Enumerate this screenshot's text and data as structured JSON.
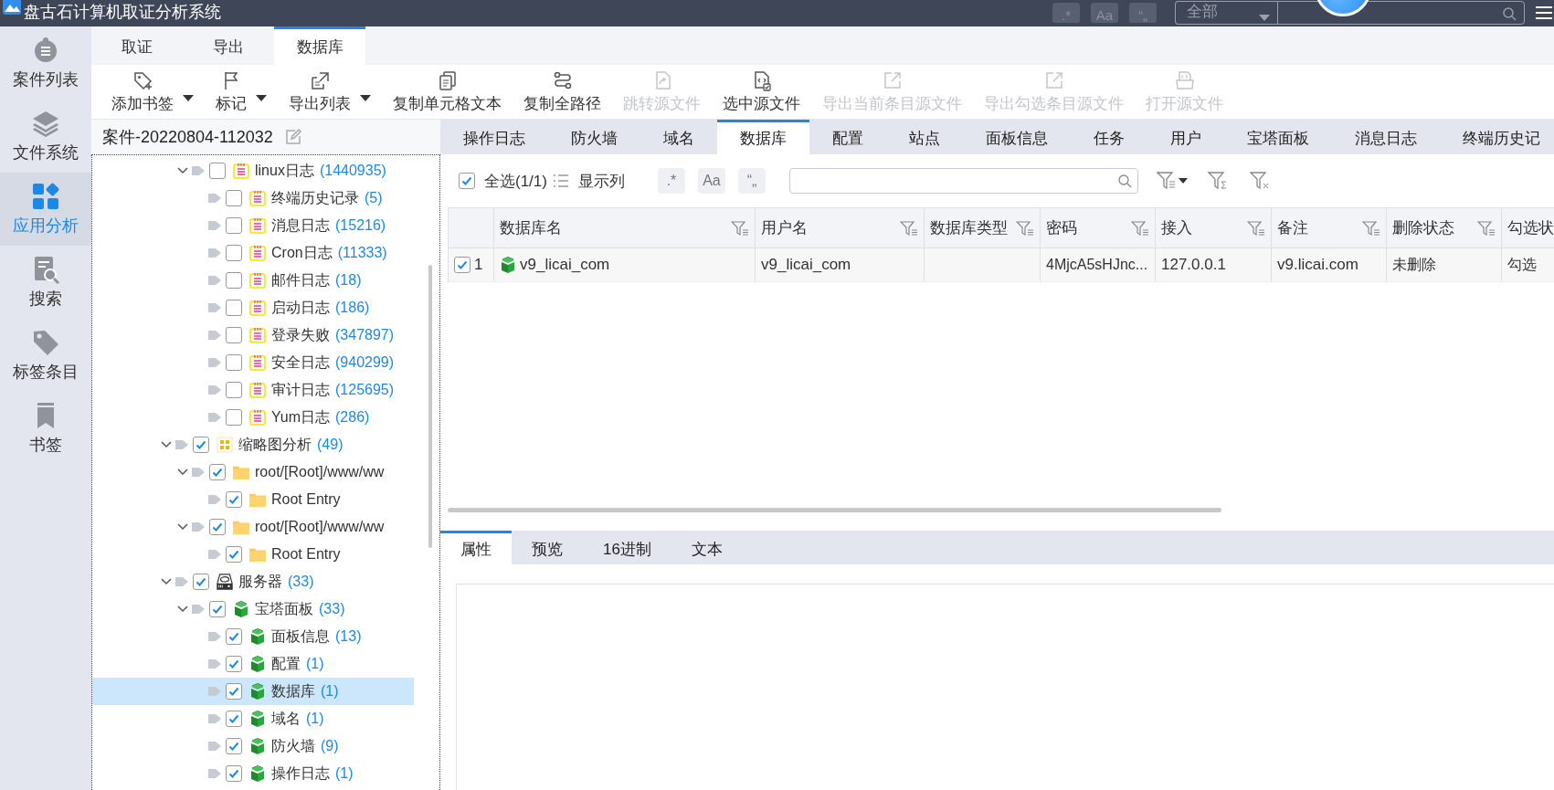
{
  "window": {
    "title": "盘古石计算机取证分析系统"
  },
  "topbar": {
    "toggles": [
      ".*",
      "Aa",
      "“„"
    ],
    "scope": "全部"
  },
  "sidebar": {
    "items": [
      {
        "label": "案件列表",
        "kind": "case",
        "selected": false
      },
      {
        "label": "文件系统",
        "kind": "layers",
        "selected": false
      },
      {
        "label": "应用分析",
        "kind": "apps",
        "selected": true
      },
      {
        "label": "搜索",
        "kind": "search",
        "selected": false
      },
      {
        "label": "标签条目",
        "kind": "tag",
        "selected": false
      },
      {
        "label": "书签",
        "kind": "bookmark",
        "selected": false
      }
    ]
  },
  "menu_tabs": [
    {
      "label": "取证",
      "selected": false
    },
    {
      "label": "导出",
      "selected": false
    },
    {
      "label": "数据库",
      "selected": true
    }
  ],
  "toolbar": [
    {
      "label": "添加书签",
      "kind": "tag",
      "dropdown": true,
      "disabled": false
    },
    {
      "label": "标记",
      "kind": "flag",
      "dropdown": true,
      "disabled": false
    },
    {
      "label": "导出列表",
      "kind": "export",
      "dropdown": true,
      "disabled": false
    },
    {
      "label": "复制单元格文本",
      "kind": "copy",
      "dropdown": false,
      "disabled": false
    },
    {
      "label": "复制全路径",
      "kind": "path",
      "dropdown": false,
      "disabled": false
    },
    {
      "label": "跳转源文件",
      "kind": "jump",
      "dropdown": false,
      "disabled": true
    },
    {
      "label": "选中源文件",
      "kind": "source",
      "dropdown": false,
      "disabled": false
    },
    {
      "label": "导出当前条目源文件",
      "kind": "external",
      "dropdown": false,
      "disabled": true
    },
    {
      "label": "导出勾选条目源文件",
      "kind": "external",
      "dropdown": false,
      "disabled": true
    },
    {
      "label": "打开源文件",
      "kind": "open",
      "dropdown": false,
      "disabled": true
    }
  ],
  "case": {
    "title": "案件-20220804-112032"
  },
  "tree": {
    "partial_branch": [
      {
        "label": "linux日志",
        "count": "(1440935)",
        "kind": "log",
        "checked": false,
        "selected": false,
        "expanded": true,
        "children": [
          {
            "label": "终端历史记录",
            "count": "(5)",
            "kind": "log",
            "checked": false,
            "selected": false
          },
          {
            "label": "消息日志",
            "count": "(15216)",
            "kind": "log",
            "checked": false,
            "selected": false
          },
          {
            "label": "Cron日志",
            "count": "(11333)",
            "kind": "log",
            "checked": false,
            "selected": false
          },
          {
            "label": "邮件日志",
            "count": "(18)",
            "kind": "log",
            "checked": false,
            "selected": false
          },
          {
            "label": "启动日志",
            "count": "(186)",
            "kind": "log",
            "checked": false,
            "selected": false
          },
          {
            "label": "登录失败",
            "count": "(347897)",
            "kind": "log",
            "checked": false,
            "selected": false
          },
          {
            "label": "安全日志",
            "count": "(940299)",
            "kind": "log",
            "checked": false,
            "selected": false
          },
          {
            "label": "审计日志",
            "count": "(125695)",
            "kind": "log",
            "checked": false,
            "selected": false
          },
          {
            "label": "Yum日志",
            "count": "(286)",
            "kind": "log",
            "checked": false,
            "selected": false
          }
        ]
      }
    ],
    "items": [
      {
        "label": "缩略图分析",
        "count": "(49)",
        "kind": "grid",
        "checked": true,
        "selected": false,
        "expanded": true,
        "children": [
          {
            "label": "root/[Root]/www/ww",
            "kind": "folder",
            "checked": true,
            "selected": false,
            "expanded": true,
            "children": [
              {
                "label": "Root Entry",
                "kind": "folder",
                "checked": true,
                "selected": false
              }
            ]
          },
          {
            "label": "root/[Root]/www/ww",
            "kind": "folder",
            "checked": true,
            "selected": false,
            "expanded": true,
            "children": [
              {
                "label": "Root Entry",
                "kind": "folder",
                "checked": true,
                "selected": false
              }
            ]
          }
        ]
      },
      {
        "label": "服务器",
        "count": "(33)",
        "kind": "server",
        "checked": true,
        "selected": false,
        "expanded": true,
        "children": [
          {
            "label": "宝塔面板",
            "count": "(33)",
            "kind": "bt",
            "checked": true,
            "selected": false,
            "expanded": true,
            "children": [
              {
                "label": "面板信息",
                "count": "(13)",
                "kind": "bt",
                "checked": true,
                "selected": false
              },
              {
                "label": "配置",
                "count": "(1)",
                "kind": "bt",
                "checked": true,
                "selected": false
              },
              {
                "label": "数据库",
                "count": "(1)",
                "kind": "bt",
                "checked": true,
                "selected": true
              },
              {
                "label": "域名",
                "count": "(1)",
                "kind": "bt",
                "checked": true,
                "selected": false
              },
              {
                "label": "防火墙",
                "count": "(9)",
                "kind": "bt",
                "checked": true,
                "selected": false
              },
              {
                "label": "操作日志",
                "count": "(1)",
                "kind": "bt",
                "checked": true,
                "selected": false
              }
            ]
          }
        ]
      }
    ]
  },
  "tabs": [
    {
      "label": "操作日志",
      "selected": false
    },
    {
      "label": "防火墙",
      "selected": false
    },
    {
      "label": "域名",
      "selected": false
    },
    {
      "label": "数据库",
      "selected": true
    },
    {
      "label": "配置",
      "selected": false
    },
    {
      "label": "站点",
      "selected": false
    },
    {
      "label": "面板信息",
      "selected": false
    },
    {
      "label": "任务",
      "selected": false
    },
    {
      "label": "用户",
      "selected": false
    },
    {
      "label": "宝塔面板",
      "selected": false
    },
    {
      "label": "消息日志",
      "selected": false
    },
    {
      "label": "终端历史记",
      "selected": false
    }
  ],
  "filter_bar": {
    "select_all": {
      "label": "全选(1/1)",
      "checked": true
    },
    "columns_label": "显示列",
    "toggles": [
      ".*",
      "Aa",
      "“„"
    ]
  },
  "table": {
    "columns": [
      {
        "label": "数据库名",
        "filter": true
      },
      {
        "label": "用户名",
        "filter": true
      },
      {
        "label": "数据库类型",
        "filter": true
      },
      {
        "label": "密码",
        "filter": true
      },
      {
        "label": "接入",
        "filter": true
      },
      {
        "label": "备注",
        "filter": true
      },
      {
        "label": "删除状态",
        "filter": true
      },
      {
        "label": "勾选状"
      }
    ],
    "rows": [
      {
        "index": "1",
        "checked": true,
        "kind": "bt",
        "cells": [
          "v9_licai_com",
          "v9_licai_com",
          null,
          "4MjcA5sHJnc...",
          "127.0.0.1",
          "v9.licai.com",
          "未删除",
          "勾选"
        ]
      }
    ]
  },
  "bottom_tabs": [
    {
      "label": "属性",
      "selected": true
    },
    {
      "label": "预览",
      "selected": false
    },
    {
      "label": "16进制",
      "selected": false
    },
    {
      "label": "文本",
      "selected": false
    }
  ]
}
